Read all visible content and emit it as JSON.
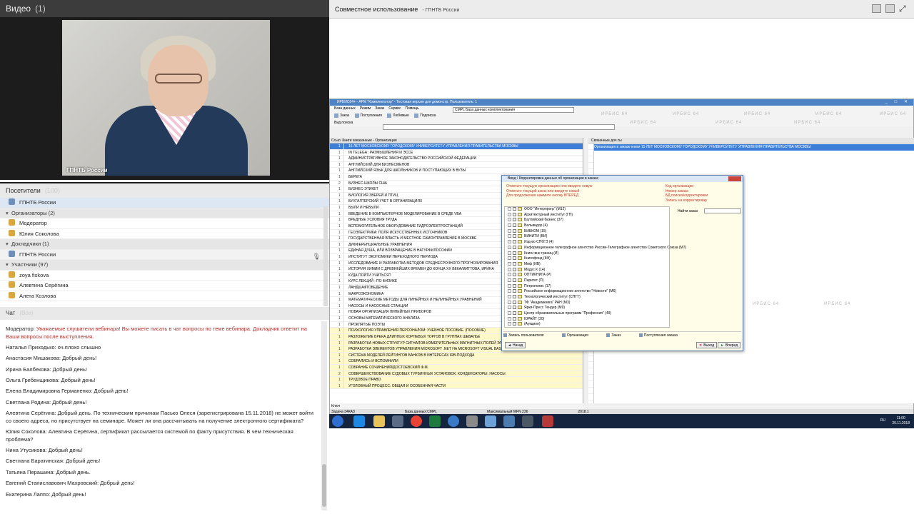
{
  "video": {
    "title": "Видео",
    "count": "(1)",
    "caption": "ГПНТБ России"
  },
  "visitors": {
    "title": "Посетители",
    "count": "(100)",
    "host": "ГПНТБ России",
    "groups": [
      {
        "label": "Организаторы (2)",
        "members": [
          "Модератор",
          "Юлия Соколова"
        ]
      },
      {
        "label": "Докладчики (1)",
        "members": [
          "ГПНТБ России"
        ]
      },
      {
        "label": "Участники (97)",
        "members": [
          "zoya fiskova",
          "Алевтина Серёгина",
          "Алета Козлова"
        ]
      }
    ]
  },
  "chat": {
    "title": "Чат",
    "scope": "(Все)",
    "messages": [
      {
        "who": "Модератор:",
        "txt": "Уважаемые слушатели вебинара! Вы можете писать в чат вопросы по теме вебинара. Докладчик ответит на Ваши вопросы после выступления."
      },
      {
        "who": "Наталья Приходько:",
        "txt": "оч.плохо слышно"
      },
      {
        "who": "Анастасия Мишакова:",
        "txt": "Добрый день!"
      },
      {
        "who": "Ирина Балбекова:",
        "txt": "Добрый день!"
      },
      {
        "who": "Ольга Гребенщикова:",
        "txt": "Добрый день!"
      },
      {
        "who": "Елена Владимировна Германенко:",
        "txt": "Добрый день!"
      },
      {
        "who": "Светлана Родина:",
        "txt": "Добрый день!"
      },
      {
        "who": "Алевтина Серёгина:",
        "txt": "Добрый день. По техническим причинам Пасько Олеся (зарегистрирована 15.11.2018) не может войти со своего адреса, но присутствует на семинаре. Может ли она рассчитывать на получение электронного сертификата?"
      },
      {
        "who": "Юлия Соколова:",
        "txt": "Алевтина Серёгина, сертификат рассылается системой по факту присутствия.  В чем техническая проблема?"
      },
      {
        "who": "Нина Утусикова:",
        "txt": "Добрый день!"
      },
      {
        "who": "Светлана Баратинская:",
        "txt": "Добрый день!"
      },
      {
        "who": "Татьяна  Перашина:",
        "txt": "Добрый день."
      },
      {
        "who": "Евгений Станиславович Махровский:",
        "txt": "Добрый день!"
      },
      {
        "who": "Екатерина Лаппо:",
        "txt": "Добрый день!"
      }
    ]
  },
  "share": {
    "title": "Совместное использование",
    "sub": "- ГПНТБ России"
  },
  "irbis": {
    "title": "ИРБИС64+ - АРМ \"Комплектатор\" - Тестовая версия для демонстр. Пользователь: 1",
    "menu": [
      "База данных",
      "Режим",
      "Заказ",
      "Сервис",
      "Помощь"
    ],
    "db": "CMPL  База данных комплектования",
    "toolbar": [
      "Заказ",
      "Поступления",
      "Любимые",
      "Подписка"
    ],
    "search_label": "Вид поиска",
    "watermark": "ИРБИС 64",
    "left_header": "Ссыл. Книги заказанные - Организация",
    "rows": [
      {
        "n": "1",
        "t": "15 ЛЕТ МОСКОВСКОМУ ГОРОДСКОМУ УНИВЕРСИТЕТУ УПРАВЛЕНИЯ ПРАВИТЕЛЬСТВА МОСКВЫ"
      },
      {
        "n": "1",
        "t": "IN TELEGA : РАЗМЫШЛЕНИЯ И ЭССЕ"
      },
      {
        "n": "1",
        "t": "АДМИНИСТРАТИВНОЕ ЗАКОНОДАТЕЛЬСТВО РОССИЙСКОЙ ФЕДЕРАЦИИ"
      },
      {
        "n": "1",
        "t": "АНГЛИЙСКИЙ ДЛЯ БИЗНЕСМЕНОВ"
      },
      {
        "n": "1",
        "t": "АНГЛИЙСКИЙ ЯЗЫК ДЛЯ ШКОЛЬНИКОВ И ПОСТУПАЮЩИХ В ВУЗЫ"
      },
      {
        "n": "1",
        "t": "БЕРЕГА"
      },
      {
        "n": "2",
        "t": "БИЗНЕС-ШКОЛЫ США"
      },
      {
        "n": "1",
        "t": "БИЗНЕС-ЭТИКЕТ"
      },
      {
        "n": "1",
        "t": "БИОЛОГИЯ ЗВЕРЕЙ И ПТИЦ"
      },
      {
        "n": "1",
        "t": "БУХГАЛТЕРСКИЙ УЧЕТ В ОРГАНИЗАЦИЯХ"
      },
      {
        "n": "1",
        "t": "БЫЛИ И НЕБЫЛИ"
      },
      {
        "n": "1",
        "t": "ВВЕДЕНИЕ В КОМПЬЮТЕРНОЕ МОДЕЛИРОВАНИЕ В СРЕДЕ VBA"
      },
      {
        "n": "1",
        "t": "ВРЕДНЫЕ УСЛОВИЯ ТРУДА"
      },
      {
        "n": "1",
        "t": "ВСПОМОГАТЕЛЬНОЕ ОБОРУДОВАНИЕ ГИДРОЭЛЕКТРОСТАНЦИЙ"
      },
      {
        "n": "1",
        "t": "ГЕОЭЛЕКТРИКА: ПОЛЯ ИСКУССТВЕННЫХ ИСТОЧНИКОВ"
      },
      {
        "n": "1",
        "t": "ГОСУДАРСТВЕННАЯ ВЛАСТЬ И МЕСТНОЕ САМОУПРАВЛЕНИЕ В МОСКВЕ"
      },
      {
        "n": "1",
        "t": "ДИФФЕРЕНЦИАЛЬНЫЕ УРАВНЕНИЯ"
      },
      {
        "n": "1",
        "t": "ЕДИНАЯ ДУША, ИЛИ ВОЗВРАЩЕНИЕ В НАТУРФИЛОСОФИИ"
      },
      {
        "n": "1",
        "t": "ИНСТИТУТ ЭКОНОМИКИ ПЕРЕХОДНОГО ПЕРИОДА"
      },
      {
        "n": "1",
        "t": "ИССЛЕДОВАНИЕ И РАЗРАБОТКА МЕТОДОВ СРЕДНЕСРОЧНОГО ПРОГНОЗИРОВАНИЯ"
      },
      {
        "n": "1",
        "t": "ИСТОРИЯ ХИМИИ С ДРЕВНЕЙШИХ ВРЕМЕН ДО КОНЦА XX ВЕКА/МИТТОВА, ИРИНА"
      },
      {
        "n": "1",
        "t": "КУДА ПОЙТИ УЧИТЬСЯ?"
      },
      {
        "n": "1",
        "t": "КУРС ЛЕКЦИЙ : ПО ФИЗИКЕ"
      },
      {
        "n": "1",
        "t": "ЛАНДШАФТОВЕДЕНИЕ"
      },
      {
        "n": "1",
        "t": "МАКРОЭКОНОМИКА"
      },
      {
        "n": "1",
        "t": "МАТЕМАТИЧЕСКИЕ МЕТОДЫ ДЛЯ ЛИНЕЙНЫХ И НЕЛИНЕЙНЫХ УРАВНЕНИЙ"
      },
      {
        "n": "1",
        "t": "НАСОСЫ И НАСОСНЫЕ СТАНЦИИ"
      },
      {
        "n": "1",
        "t": "НОВАЯ ОРГАНИЗАЦИЯ ЛИНЕЙНЫХ ПРИБОРОВ"
      },
      {
        "n": "1",
        "t": "ОСНОВЫ МАТЕМАТИЧЕСКОГО АНАЛИЗА"
      },
      {
        "n": "1",
        "t": "ПРОКЛЯТЫЕ ПОЭТЫ"
      },
      {
        "n": "1",
        "t": "ПСИХОЛОГИЯ УПРАВЛЕНИЯ ПЕРСОНАЛОМ: УЧЕБНОЕ ПОСОБИЕ. (ПОСОБИЕ)"
      },
      {
        "n": "1",
        "t": "РАЗЛОЖЕНИЕ БРЕКА ДЛИННЫХ КОРНЕВЫХ ТОРГОВ В ГРУППАХ ШЕВАЛЬЕ"
      },
      {
        "n": "1",
        "t": "РАЗРАБОТКА НОВЫХ СТРУКТУР СИГНАЛОВ ИЗМЕРИТЕЛЬНЫХ МАГНИТНЫХ ПОЛЕЙ ЭЛЕКТРО"
      },
      {
        "n": "1",
        "t": "РАЗРАБОТКА ЭЛЕМЕНТОВ УПРАВЛЕНИЯ MICROSOFT .NET НА MICROSOFT VISUAL BASIC .NET"
      },
      {
        "n": "1",
        "t": "СИСТЕМА МОДЕЛЕЙ РЕЙТИНГОВ БАНКОВ В ИНТЕРЕСАХ IRB-ПОДХОДА"
      },
      {
        "n": "1",
        "t": "СОБРАЛИСЬ И ВСПОМНИЛИ"
      },
      {
        "n": "1",
        "t": "СОБРАНИЕ СОЧИНЕНИЙ/ДОСТОЕВСКИЙ Ф.М."
      },
      {
        "n": "2",
        "t": "СОВЕРШЕНСТВОВАНИЕ СУДОВЫХ ТУРБИННЫХ УСТАНОВОК. КОНДЕНСАТОРЫ. НАСОСЫ"
      },
      {
        "n": "1",
        "t": "ТРУДОВОЕ ПРАВО"
      },
      {
        "n": "1",
        "t": "УГОЛОВНЫЙ ПРОЦЕСС: ОБЩАЯ И ОСОБЕННАЯ ЧАСТИ"
      }
    ],
    "right_header": "Связанные доч.ты",
    "right_row": "Организация в заказе книги  15 ЛЕТ МОСКОВСКОМУ ГОРОДСКОМУ УНИВЕРСИТЕТУ УПРАВЛЕНИЯ ПРАВИТЕЛЬСТВА МОСКВЫ",
    "key_label": "Ключ",
    "status": [
      "Задача 34КАЗ",
      "База данных:CMPL",
      "Максимальный MFN 236"
    ],
    "version": "2018.1"
  },
  "dialog": {
    "title": "Ввод / Корректировка данных об организации в заказе",
    "hints_left": [
      "Отметьте текущую организацию или введите новую",
      "Отметьте текущий заказ или введите новый",
      "Для продолжения нажмите кнопку ВПЕРЕД"
    ],
    "hints_right": [
      "Код организации",
      "Номер заказа",
      "БД поиска/корректировки",
      "Запись на корректировку"
    ],
    "find_label": "Найти заказ",
    "tree": [
      "ООО \"Интерпрогр\" (М12)",
      "Архитектурный институт (ГП)",
      "Балтийский бизнес (37)",
      "Вельвидор (4)",
      "БИБКОМ (15)",
      "ВИНИТИ (ВИ)",
      "Изд-во СПбГЭ (4)",
      "Информационное телеграфное агентство России-Телеграфное агентство Советского Союза (М7)",
      "Книги вне границ (И)",
      "Книгофонд (КФ)",
      "Миф (ИВ)",
      "Модус К (14)",
      "ОПТИКНИГА (Р)",
      "Паритет (П)",
      "Петрополис (17)",
      "Российское информационное агентство \"Новости\" (М6)",
      "Технологический институт (СПГТ)",
      "ТФ \"Академкнига\" РАН (М3)",
      "Ярки-Пресс Тендер (М9)",
      "Центр образовательных программ \"Профессия\" (49)",
      "ЮРАЙТ (20)",
      "(Аукцион)"
    ],
    "tabs": [
      "Запись пользователя",
      "Организация",
      "Заказ",
      "Поступления заказа"
    ],
    "back": "Назад",
    "exit": "Выход",
    "next": "Вперед"
  },
  "taskbar": {
    "lang": "RU",
    "time": "11:00",
    "date": "20.11.2018"
  }
}
